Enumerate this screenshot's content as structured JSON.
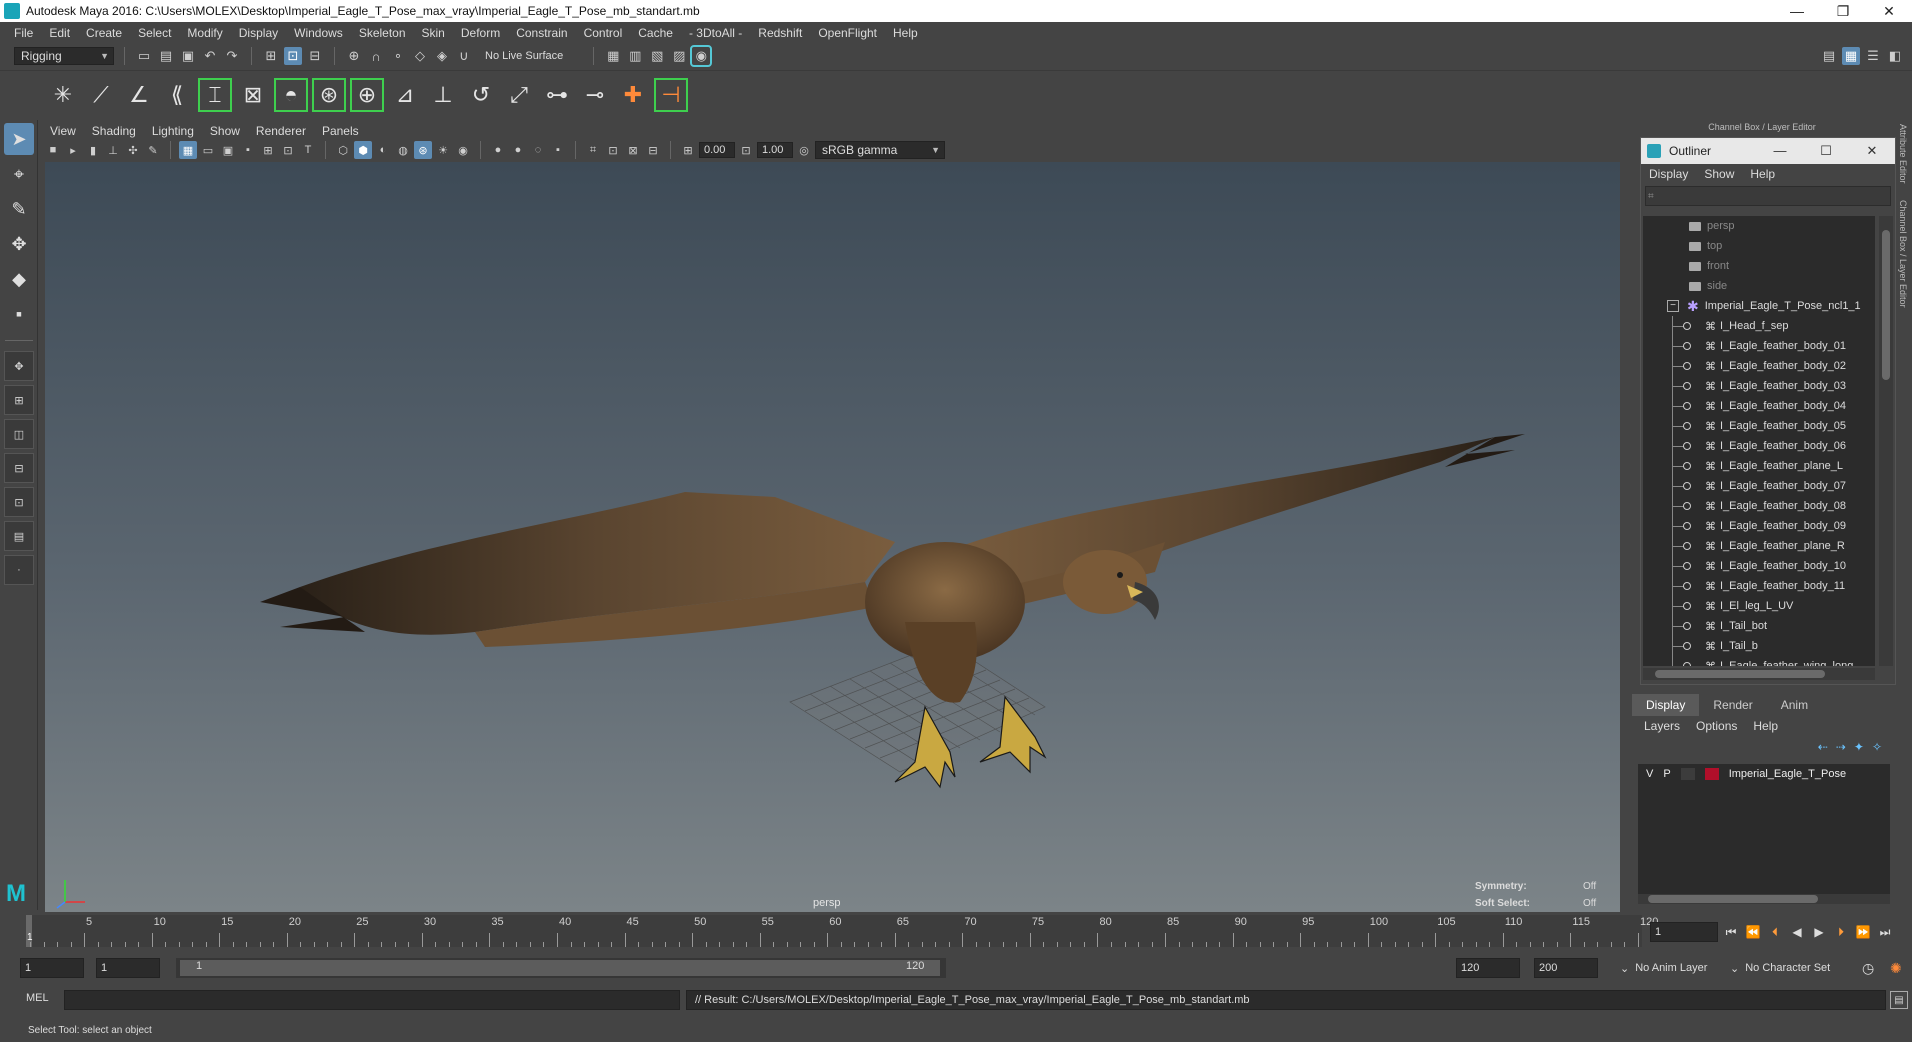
{
  "window": {
    "title": "Autodesk Maya 2016: C:\\Users\\MOLEX\\Desktop\\Imperial_Eagle_T_Pose_max_vray\\Imperial_Eagle_T_Pose_mb_standart.mb",
    "min": "—",
    "max": "❐",
    "close": "✕"
  },
  "menus": [
    "File",
    "Edit",
    "Create",
    "Select",
    "Modify",
    "Display",
    "Windows",
    "Skeleton",
    "Skin",
    "Deform",
    "Constrain",
    "Control",
    "Cache",
    "- 3DtoAll -",
    "Redshift",
    "OpenFlight",
    "Help"
  ],
  "status": {
    "menuset": "Rigging",
    "live_surface": "No Live Surface"
  },
  "viewport": {
    "menus": [
      "View",
      "Shading",
      "Lighting",
      "Show",
      "Renderer",
      "Panels"
    ],
    "exposure": "0.00",
    "gamma": "1.00",
    "colorspace": "sRGB gamma",
    "camera_label": "persp",
    "hud": {
      "symmetry_label": "Symmetry:",
      "symmetry_value": "Off",
      "soft_label": "Soft Select:",
      "soft_value": "Off"
    }
  },
  "right_panel": {
    "header": "Channel Box / Layer Editor",
    "side_tabs": [
      "Attribute Editor",
      "Channel Box / Layer Editor"
    ]
  },
  "outliner": {
    "title": "Outliner",
    "menus": [
      "Display",
      "Show",
      "Help"
    ],
    "cameras": [
      "persp",
      "top",
      "front",
      "side"
    ],
    "root": "Imperial_Eagle_T_Pose_ncl1_1",
    "children": [
      "I_Head_f_sep",
      "I_Eagle_feather_body_01",
      "I_Eagle_feather_body_02",
      "I_Eagle_feather_body_03",
      "I_Eagle_feather_body_04",
      "I_Eagle_feather_body_05",
      "I_Eagle_feather_body_06",
      "I_Eagle_feather_plane_L",
      "I_Eagle_feather_body_07",
      "I_Eagle_feather_body_08",
      "I_Eagle_feather_body_09",
      "I_Eagle_feather_plane_R",
      "I_Eagle_feather_body_10",
      "I_Eagle_feather_body_11",
      "I_El_leg_L_UV",
      "I_Tail_bot",
      "I_Tail_b",
      "I_Eagle_feather_wing_long"
    ]
  },
  "layer_editor": {
    "tabs": [
      "Display",
      "Render",
      "Anim"
    ],
    "menus": [
      "Layers",
      "Options",
      "Help"
    ],
    "layer": {
      "v": "V",
      "p": "P",
      "name": "Imperial_Eagle_T_Pose",
      "color": "#b10f2a"
    }
  },
  "timeline": {
    "start": 1,
    "end": 120,
    "current": "1",
    "ticks": [
      5,
      10,
      15,
      20,
      25,
      30,
      35,
      40,
      45,
      50,
      55,
      60,
      65,
      70,
      75,
      80,
      85,
      90,
      95,
      100,
      105,
      110,
      115,
      120
    ],
    "current_frame_field": "1"
  },
  "range": {
    "start_field": "1",
    "playback_start": "1",
    "range_start_label": "1",
    "range_end_label": "120",
    "playback_end": "120",
    "end_field": "200",
    "anim_layer": "No Anim Layer",
    "char_set": "No Character Set"
  },
  "command": {
    "lang": "MEL",
    "result": "// Result: C:/Users/MOLEX/Desktop/Imperial_Eagle_T_Pose_max_vray/Imperial_Eagle_T_Pose_mb_standart.mb"
  },
  "help_line": "Select Tool: select an object"
}
